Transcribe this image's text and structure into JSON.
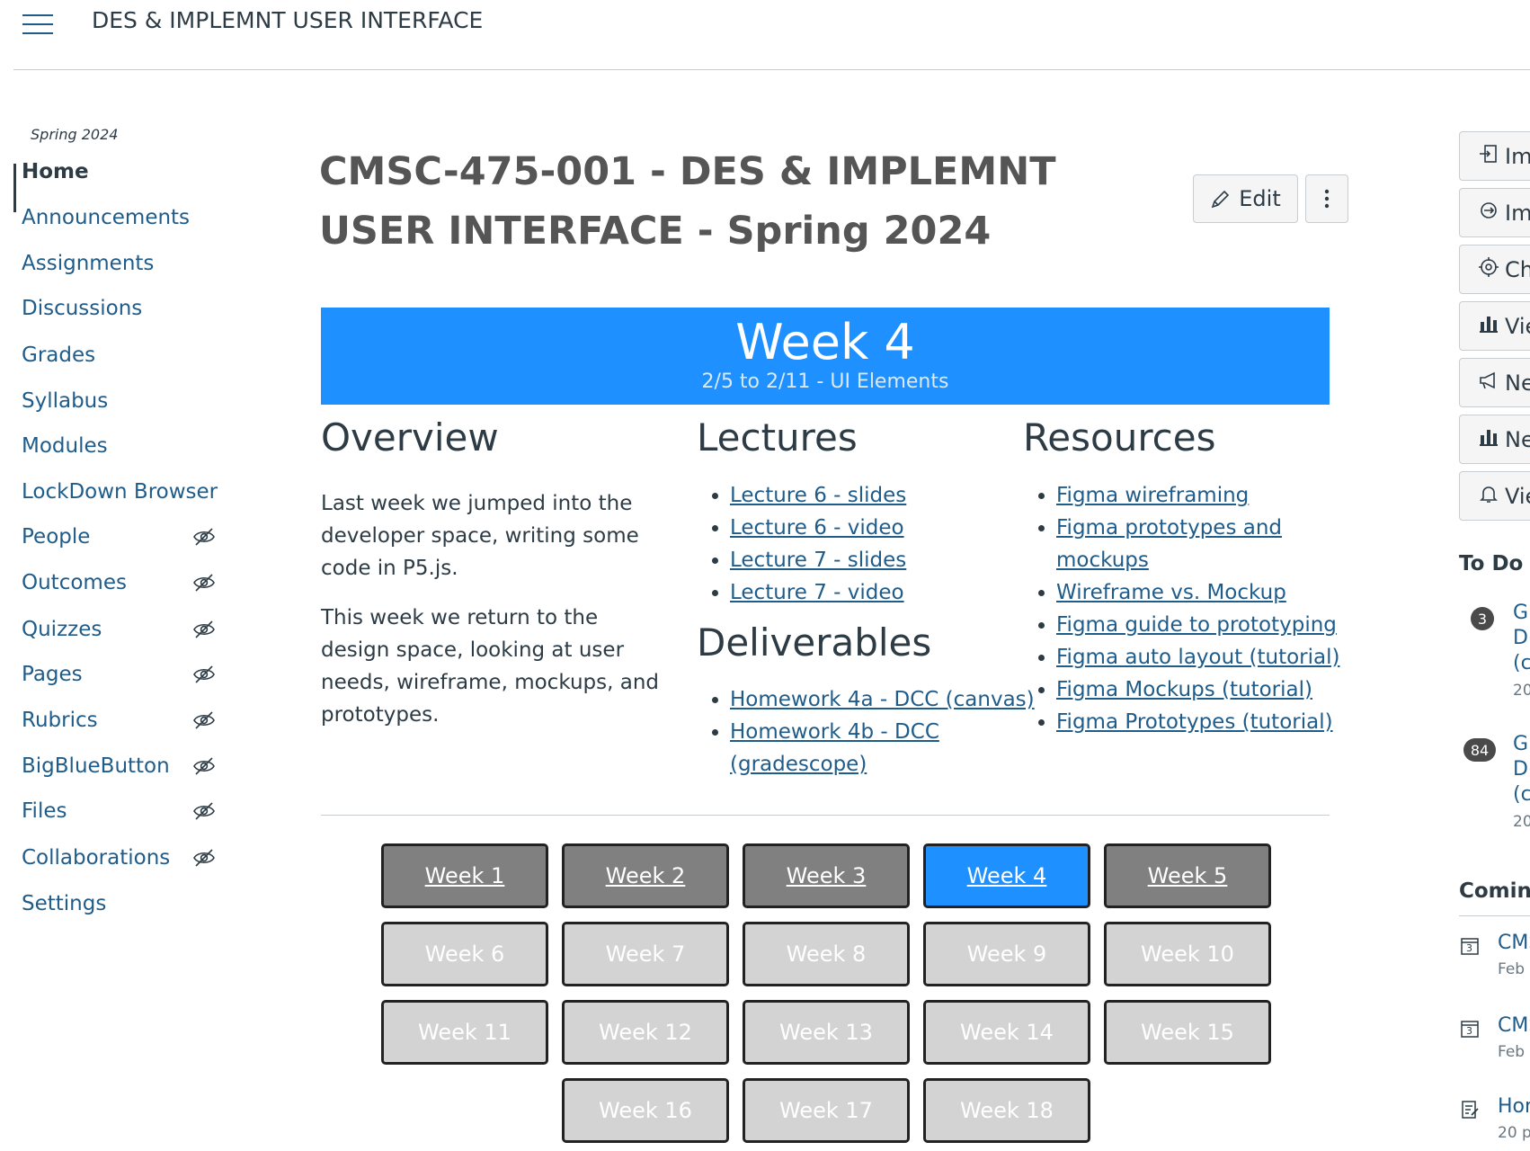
{
  "header": {
    "course_name": "DES & IMPLEMNT USER INTERFACE"
  },
  "nav": {
    "term": "Spring 2024",
    "items": [
      {
        "label": "Home",
        "active": true,
        "hidden": false
      },
      {
        "label": "Announcements",
        "hidden": false
      },
      {
        "label": "Assignments",
        "hidden": false
      },
      {
        "label": "Discussions",
        "hidden": false
      },
      {
        "label": "Grades",
        "hidden": false
      },
      {
        "label": "Syllabus",
        "hidden": false
      },
      {
        "label": "Modules",
        "hidden": false
      },
      {
        "label": "LockDown Browser",
        "hidden": false
      },
      {
        "label": "People",
        "hidden": true
      },
      {
        "label": "Outcomes",
        "hidden": true
      },
      {
        "label": "Quizzes",
        "hidden": true
      },
      {
        "label": "Pages",
        "hidden": true
      },
      {
        "label": "Rubrics",
        "hidden": true
      },
      {
        "label": "BigBlueButton",
        "hidden": true
      },
      {
        "label": "Files",
        "hidden": true
      },
      {
        "label": "Collaborations",
        "hidden": true
      },
      {
        "label": "Settings",
        "hidden": false
      }
    ]
  },
  "page": {
    "title": "CMSC-475-001 - DES & IMPLEMNT USER INTERFACE - Spring 2024",
    "edit_label": "Edit"
  },
  "banner": {
    "title": "Week 4",
    "subtitle": "2/5 to 2/11 - UI Elements"
  },
  "overview": {
    "heading": "Overview",
    "p1": "Last week we jumped into the developer space, writing some code in P5.js.",
    "p2": "This week we return to the design space, looking at user needs, wireframe, mockups, and prototypes."
  },
  "lectures": {
    "heading": "Lectures",
    "items": [
      "Lecture 6 - slides",
      "Lecture 6 - video",
      "Lecture 7 - slides",
      "Lecture 7 - video"
    ]
  },
  "deliverables": {
    "heading": "Deliverables",
    "items": [
      "Homework 4a - DCC (canvas)",
      "Homework 4b - DCC (gradescope)"
    ]
  },
  "resources": {
    "heading": "Resources",
    "items": [
      "Figma wireframing",
      "Figma prototypes and mockups",
      "Wireframe vs. Mockup",
      "Figma guide to prototyping",
      "Figma auto layout (tutorial)",
      "Figma Mockups (tutorial)",
      "Figma Prototypes (tutorial)"
    ]
  },
  "weeks": [
    {
      "label": "Week 1",
      "state": "past"
    },
    {
      "label": "Week 2",
      "state": "past"
    },
    {
      "label": "Week 3",
      "state": "past"
    },
    {
      "label": "Week 4",
      "state": "current"
    },
    {
      "label": "Week 5",
      "state": "past"
    },
    {
      "label": "Week 6",
      "state": "future"
    },
    {
      "label": "Week 7",
      "state": "future"
    },
    {
      "label": "Week 8",
      "state": "future"
    },
    {
      "label": "Week 9",
      "state": "future"
    },
    {
      "label": "Week 10",
      "state": "future"
    },
    {
      "label": "Week 11",
      "state": "future"
    },
    {
      "label": "Week 12",
      "state": "future"
    },
    {
      "label": "Week 13",
      "state": "future"
    },
    {
      "label": "Week 14",
      "state": "future"
    },
    {
      "label": "Week 15",
      "state": "future"
    },
    {
      "label": "Week 16",
      "state": "future"
    },
    {
      "label": "Week 17",
      "state": "future"
    },
    {
      "label": "Week 18",
      "state": "future"
    }
  ],
  "sidebar": {
    "buttons": [
      {
        "label": "Im",
        "icon": "import-icon"
      },
      {
        "label": "Im",
        "icon": "import-commons-icon"
      },
      {
        "label": "Ch",
        "icon": "target-icon"
      },
      {
        "label": "Vie",
        "icon": "bar-chart-icon"
      },
      {
        "label": "Ne",
        "icon": "megaphone-icon"
      },
      {
        "label": "Ne",
        "icon": "bar-chart-icon"
      },
      {
        "label": "Vie",
        "icon": "bell-icon"
      }
    ],
    "todo": {
      "heading": "To Do",
      "items": [
        {
          "badge": "3",
          "lines": [
            "Gr",
            "D(",
            "(ca"
          ],
          "meta": "20"
        },
        {
          "badge": "84",
          "lines": [
            "Gr",
            "D(",
            "(ca"
          ],
          "meta": "20"
        }
      ]
    },
    "coming": {
      "heading": "Coming",
      "items": [
        {
          "title": "CMS",
          "meta": "Feb",
          "icon": "calendar-icon",
          "icon_text": "3"
        },
        {
          "title": "CMS",
          "meta": "Feb",
          "icon": "calendar-icon",
          "icon_text": "3"
        },
        {
          "title": "Hon",
          "meta": "20 p",
          "icon": "assignment-icon"
        }
      ]
    }
  },
  "colors": {
    "accent": "#1e90ff",
    "link": "#1f5c8a",
    "week_past": "#808080",
    "week_future": "#d3d3d3"
  }
}
